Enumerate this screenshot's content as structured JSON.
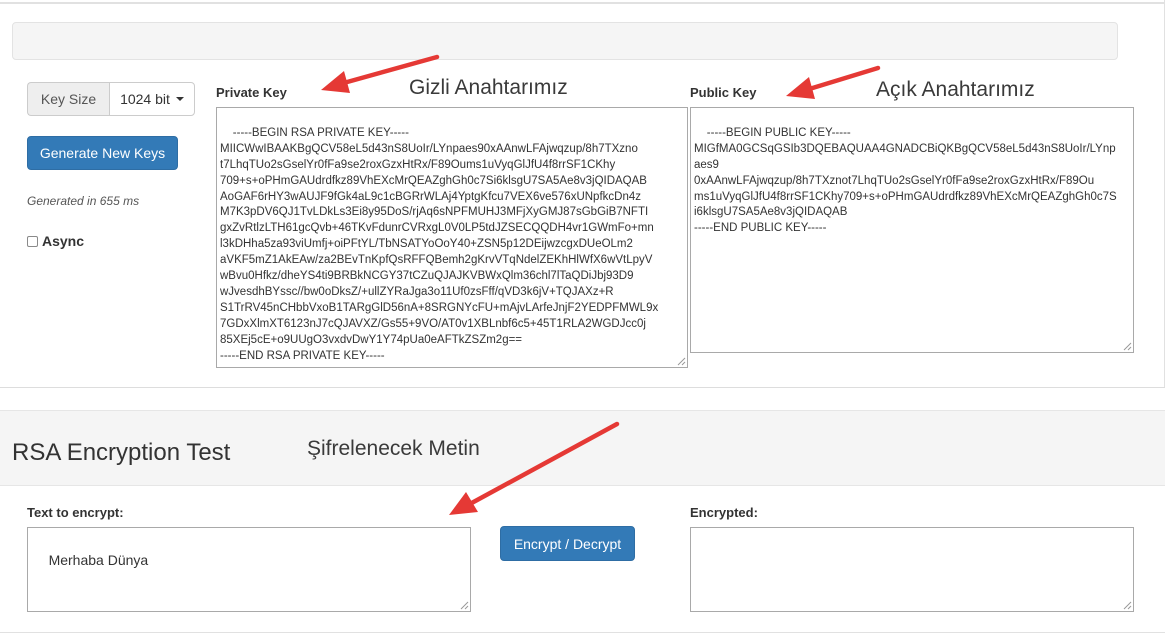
{
  "key_controls": {
    "key_size_label": "Key Size",
    "key_size_value": "1024 bit",
    "generate_label": "Generate New Keys",
    "generated_time": "Generated in 655 ms",
    "async_label": "Async"
  },
  "private_key": {
    "label": "Private Key",
    "annotation": "Gizli Anahtarımız",
    "value": "-----BEGIN RSA PRIVATE KEY-----\nMIICWwIBAAKBgQCV58eL5d43nS8UoIr/LYnpaes90xAAnwLFAjwqzup/8h7TXzno\nt7LhqTUo2sGselYr0fFa9se2roxGzxHtRx/F89Oums1uVyqGlJfU4f8rrSF1CKhy\n709+s+oPHmGAUdrdfkz89VhEXcMrQEAZghGh0c7Si6klsgU7SA5Ae8v3jQIDAQAB\nAoGAF6rHY3wAUJF9fGk4aL9c1cBGRrWLAj4YptgKfcu7VEX6ve576xUNpfkcDn4z\nM7K3pDV6QJ1TvLDkLs3Ei8y95DoS/rjAq6sNPFMUHJ3MFjXyGMJ87sGbGiB7NFTI\ngxZvRtlzLTH61gcQvb+46TKvFdunrCVRxgL0V0LP5tdJZSECQQDH4vr1GWmFo+mn\nl3kDHha5za93viUmfj+oiPFtYL/TbNSATYoOoY40+ZSN5p12DEijwzcgxDUeOLm2\naVKF5mZ1AkEAw/za2BEvTnKpfQsRFFQBemh2gKrvVTqNdelZEKhHlWfX6wVtLpyV\nwBvu0Hfkz/dheYS4ti9BRBkNCGY37tCZuQJAJKVBWxQlm36chl7lTaQDiJbj93D9\nwJvesdhBYssc//bw0oDksZ/+ullZYRaJga3o11Uf0zsFff/qVD3k6jV+TQJAXz+R\nS1TrRV45nCHbbVxoB1TARgGlD56nA+8SRGNYcFU+mAjvLArfeJnjF2YEDPFMWL9x\n7GDxXlmXT6123nJ7cQJAVXZ/Gs55+9VO/AT0v1XBLnbf6c5+45T1RLA2WGDJcc0j\n85XEj5cE+o9UUgO3vxdvDwY1Y74pUa0eAFTkZSZm2g==\n-----END RSA PRIVATE KEY-----"
  },
  "public_key": {
    "label": "Public Key",
    "annotation": "Açık Anahtarımız",
    "value": "-----BEGIN PUBLIC KEY-----\nMIGfMA0GCSqGSIb3DQEBAQUAA4GNADCBiQKBgQCV58eL5d43nS8UoIr/LYnp\naes9\n0xAAnwLFAjwqzup/8h7TXznot7LhqTUo2sGselYr0fFa9se2roxGzxHtRx/F89Ou\nms1uVyqGlJfU4f8rrSF1CKhy709+s+oPHmGAUdrdfkz89VhEXcMrQEAZghGh0c7S\ni6klsgU7SA5Ae8v3jQIDAQAB\n-----END PUBLIC KEY-----"
  },
  "encryption_test": {
    "title": "RSA Encryption Test",
    "annotation": "Şifrelenecek Metin",
    "text_label": "Text to encrypt:",
    "text_value": "Merhaba Dünya",
    "button_label": "Encrypt / Decrypt",
    "encrypted_label": "Encrypted:",
    "encrypted_value": ""
  },
  "colors": {
    "primary_button": "#337ab7",
    "annotation_arrow": "#e53935"
  },
  "icons": [
    "caret-down-icon",
    "resize-grip-icon",
    "annotation-arrow-icon"
  ]
}
